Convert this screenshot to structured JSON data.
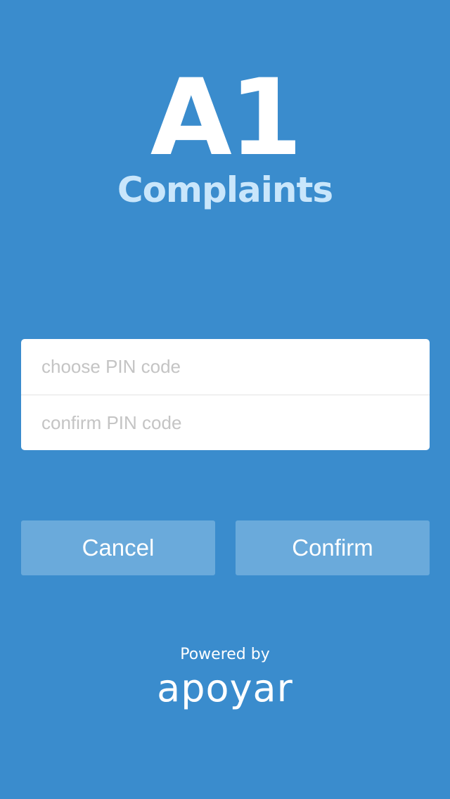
{
  "app": {
    "logo_main": "A1",
    "logo_sub": "Complaints"
  },
  "form": {
    "pin_placeholder": "choose PIN code",
    "pin_value": "",
    "confirm_pin_placeholder": "confirm PIN code",
    "confirm_pin_value": ""
  },
  "actions": {
    "cancel_label": "Cancel",
    "confirm_label": "Confirm"
  },
  "footer": {
    "powered_by": "Powered by",
    "brand": "apoyar"
  },
  "colors": {
    "background": "#3a8ccd",
    "subtitle": "#c9e6fb",
    "button": "#6aaadb",
    "placeholder": "#c4c4c4"
  }
}
